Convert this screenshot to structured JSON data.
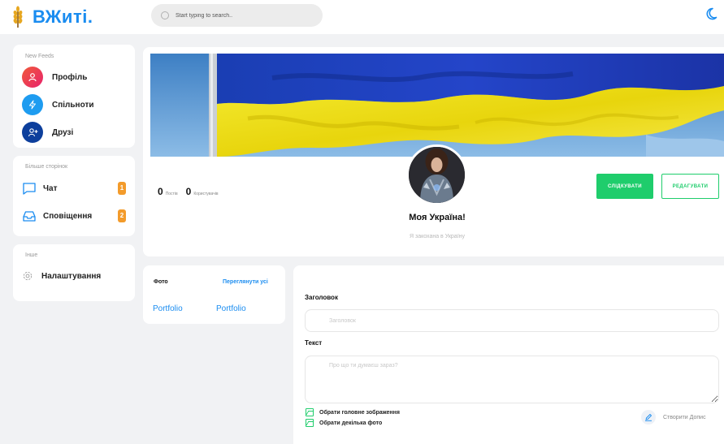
{
  "header": {
    "logo_text": "ВЖиті.",
    "search_placeholder": "Start typing to search..",
    "theme_icon": "moon-icon"
  },
  "sidebar": {
    "feeds_title": "New Feeds",
    "feeds": [
      {
        "label": "Профіль",
        "icon": "user-icon",
        "color": "#f2345a"
      },
      {
        "label": "Спільноти",
        "icon": "bolt-icon",
        "color": "#1e9cf0"
      },
      {
        "label": "Друзі",
        "icon": "user-plus-icon",
        "color": "#0d3f9c"
      }
    ],
    "pages_title": "Більше сторінок",
    "pages": [
      {
        "label": "Чат",
        "icon": "chat-icon",
        "count": "1"
      },
      {
        "label": "Сповіщення",
        "icon": "inbox-icon",
        "count": "2"
      }
    ],
    "other_title": "Інше",
    "other": [
      {
        "label": "Налаштування",
        "icon": "gear-icon"
      }
    ]
  },
  "profile": {
    "posts_count": "0",
    "posts_label": "Постів",
    "users_count": "0",
    "users_label": "Користувачів",
    "name": "Моя Україна!",
    "bio": "Я закохана в Україну",
    "follow_label": "СЛІДКУВАТИ",
    "edit_label": "РЕДАГУВАТИ"
  },
  "photos": {
    "title": "Фото",
    "view_all": "Переглянути усі",
    "items": [
      "Portfolio",
      "Portfolio"
    ]
  },
  "post": {
    "title_label": "Заголовок",
    "title_placeholder": "Заголовок",
    "text_label": "Текст",
    "text_placeholder": "Про що ти думаєш зараз?",
    "main_image_label": "Обрати головне зображення",
    "multi_photo_label": "Обрати декілька фото",
    "create_label": "Створити Допис"
  },
  "colors": {
    "accent": "#1a8cf0",
    "green": "#1fcd6c",
    "badge": "#f39b2b"
  }
}
